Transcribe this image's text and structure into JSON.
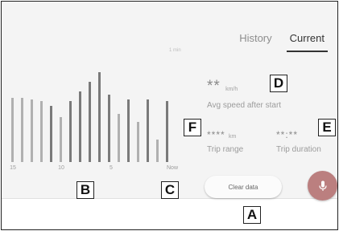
{
  "tabs": [
    {
      "label": "History",
      "active": false
    },
    {
      "label": "Current",
      "active": true
    }
  ],
  "chart": {
    "unit_note": "1 min",
    "ticks": [
      "15",
      "10",
      "5",
      "Now"
    ],
    "bar_levels": [
      0.4,
      0.4,
      0.39,
      0.38,
      0.35,
      0.28,
      0.38,
      0.44,
      0.5,
      0.56,
      0.42,
      0.3,
      0.39,
      0.25,
      0.39,
      0.14,
      0.38
    ],
    "bar_colors": {
      "light": "#b0b0b0",
      "dark": "#7a7a7a"
    }
  },
  "metrics": {
    "avg_speed": {
      "value": "**",
      "unit": "km/h",
      "label": "Avg speed after start"
    },
    "trip_range": {
      "value": "****",
      "unit": "km",
      "label": "Trip range"
    },
    "trip_duration": {
      "value": "**:**",
      "label": "Trip duration"
    }
  },
  "buttons": {
    "clear_data": "Clear data",
    "mic_icon": "microphone-icon"
  },
  "callouts": {
    "a": "A",
    "b": "B",
    "c": "C",
    "d": "D",
    "e": "E",
    "f": "F"
  },
  "colors": {
    "screen_bg": "#f4f4f4",
    "text_muted": "#9c9c9c",
    "mic_button": "#bb7f7f",
    "active_tab_underline": "#333333"
  }
}
